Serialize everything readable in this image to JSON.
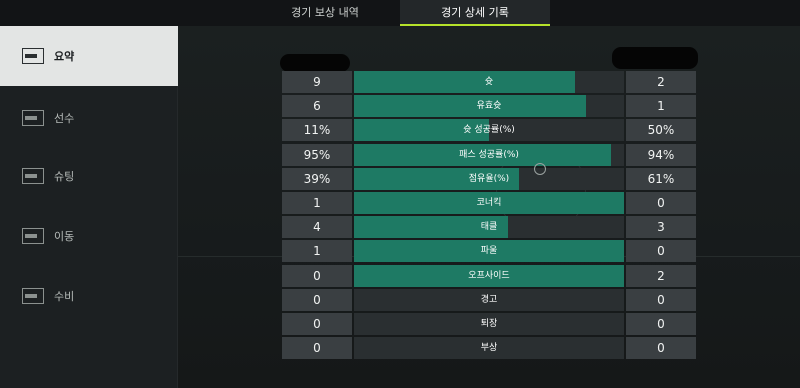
{
  "tabs": [
    {
      "label": "경기 보상 내역",
      "active": false
    },
    {
      "label": "경기 상세 기록",
      "active": true
    }
  ],
  "sidebar": {
    "items": [
      {
        "label": "요약",
        "icon": "summary-icon",
        "active": true
      },
      {
        "label": "선수",
        "icon": "players-icon",
        "active": false
      },
      {
        "label": "슈팅",
        "icon": "shooting-icon",
        "active": false
      },
      {
        "label": "이동",
        "icon": "movement-icon",
        "active": false
      },
      {
        "label": "수비",
        "icon": "defense-icon",
        "active": false
      }
    ]
  },
  "colors": {
    "accent": "#b6e22a",
    "bar_fill": "#1e7a64",
    "value_box": "#3a3f42"
  },
  "stats": [
    {
      "label": "슛",
      "left": "9",
      "right": "2",
      "fill": 0.82
    },
    {
      "label": "유효슛",
      "left": "6",
      "right": "1",
      "fill": 0.86
    },
    {
      "label": "슛 성공률(%)",
      "left": "11%",
      "right": "50%",
      "fill": 0.5
    },
    {
      "label": "패스 성공률(%)",
      "left": "95%",
      "right": "94%",
      "fill": 0.95
    },
    {
      "label": "점유율(%)",
      "left": "39%",
      "right": "61%",
      "fill": 0.61
    },
    {
      "label": "코너킥",
      "left": "1",
      "right": "0",
      "fill": 1.0
    },
    {
      "label": "태클",
      "left": "4",
      "right": "3",
      "fill": 0.57
    },
    {
      "label": "파울",
      "left": "1",
      "right": "0",
      "fill": 1.0
    },
    {
      "label": "오프사이드",
      "left": "0",
      "right": "2",
      "fill": 1.0
    },
    {
      "label": "경고",
      "left": "0",
      "right": "0",
      "fill": 0
    },
    {
      "label": "퇴장",
      "left": "0",
      "right": "0",
      "fill": 0
    },
    {
      "label": "부상",
      "left": "0",
      "right": "0",
      "fill": 0
    }
  ]
}
